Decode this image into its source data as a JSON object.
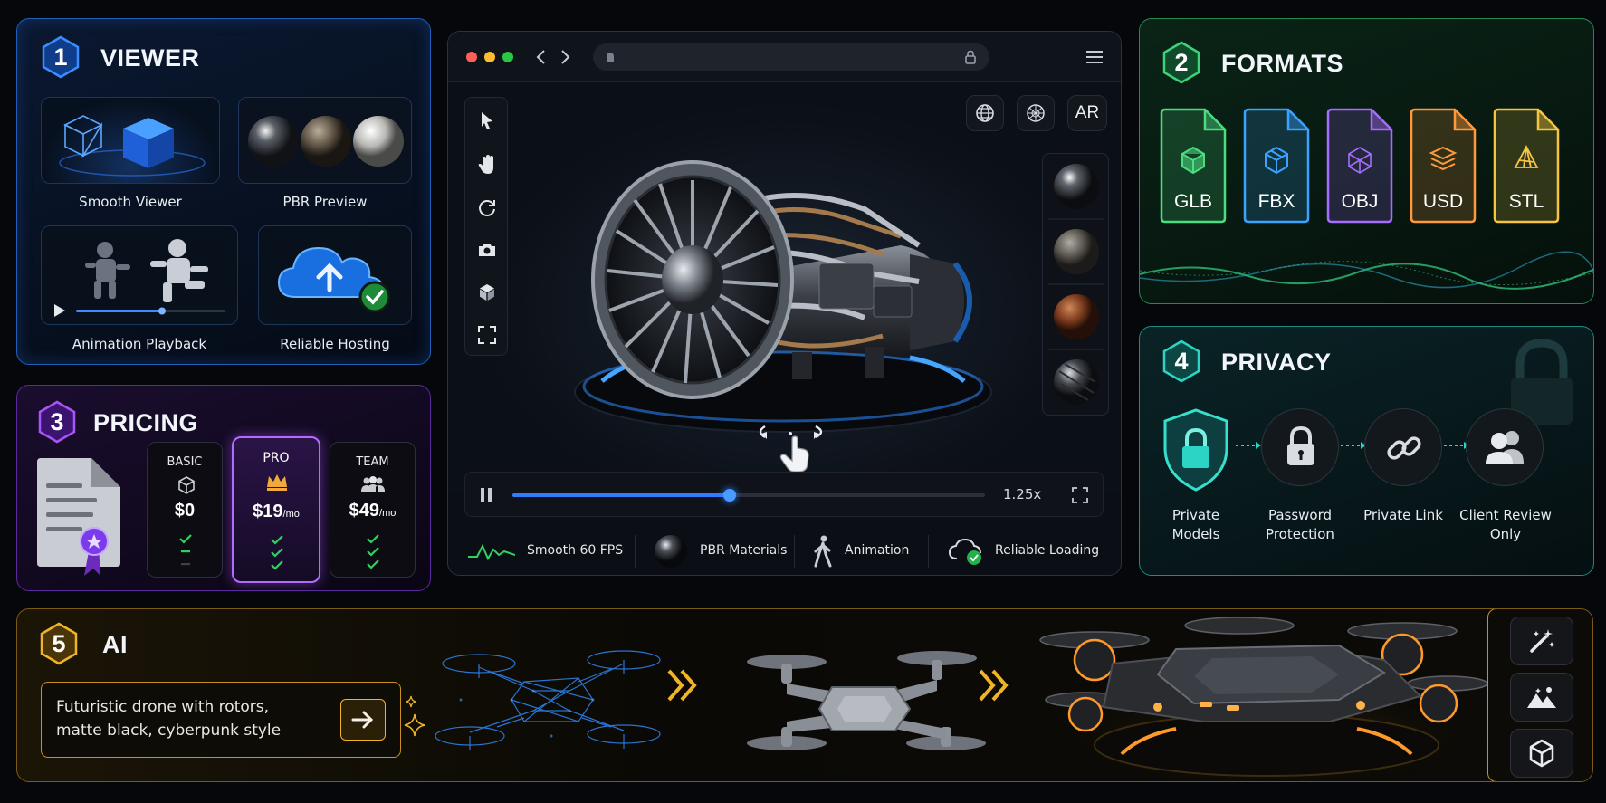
{
  "viewer": {
    "number": "1",
    "title": "VIEWER",
    "items": [
      {
        "label": "Smooth Viewer"
      },
      {
        "label": "PBR Preview"
      },
      {
        "label": "Animation Playback"
      },
      {
        "label": "Reliable Hosting"
      }
    ]
  },
  "pricing": {
    "number": "3",
    "title": "PRICING",
    "plans": [
      {
        "name": "BASIC",
        "price": "$0",
        "period": "",
        "icon": "cube-icon"
      },
      {
        "name": "PRO",
        "price": "$19",
        "period": "/mo",
        "icon": "crown-icon"
      },
      {
        "name": "TEAM",
        "price": "$49",
        "period": "/mo",
        "icon": "users-icon"
      }
    ],
    "colors": {
      "accent": "#a855f7"
    }
  },
  "browser": {
    "ar_label": "AR",
    "speed": "1.25x",
    "progress": 0.46,
    "features": [
      {
        "label": "Smooth 60 FPS",
        "icon": "fps-wave-icon"
      },
      {
        "label": "PBR Materials",
        "icon": "sphere-icon"
      },
      {
        "label": "Animation",
        "icon": "walking-person-icon"
      },
      {
        "label": "Reliable Loading",
        "icon": "cloud-check-icon"
      }
    ]
  },
  "formats": {
    "number": "2",
    "title": "FORMATS",
    "files": [
      {
        "ext": "GLB",
        "color": "#4ade80"
      },
      {
        "ext": "FBX",
        "color": "#3ba3ff"
      },
      {
        "ext": "OBJ",
        "color": "#a66bff"
      },
      {
        "ext": "USD",
        "color": "#ff9a3c"
      },
      {
        "ext": "STL",
        "color": "#f5c542"
      }
    ]
  },
  "privacy": {
    "number": "4",
    "title": "PRIVACY",
    "items": [
      {
        "label1": "Private",
        "label2": "Models"
      },
      {
        "label1": "Password",
        "label2": "Protection"
      },
      {
        "label1": "Private Link",
        "label2": ""
      },
      {
        "label1": "Client Review",
        "label2": "Only"
      }
    ]
  },
  "ai": {
    "number": "5",
    "title": "AI",
    "prompt_line1": "Futuristic drone with rotors,",
    "prompt_line2": "matte black, cyberpunk style"
  },
  "colors": {
    "viewer": "#2f7cff",
    "formats": "#3dd17a",
    "pricing": "#a855f7",
    "privacy": "#2bd4c4",
    "ai": "#f0b429"
  }
}
